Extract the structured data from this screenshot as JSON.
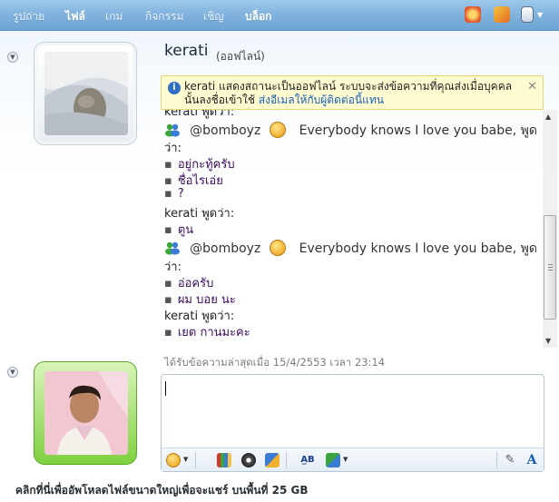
{
  "menu": {
    "photos": "รูปถ่าย",
    "files": "ไฟล์",
    "games": "เกม",
    "activities": "กิจกรรม",
    "invite": "เชิญ",
    "block": "บล็อก"
  },
  "icons": {
    "collapse_top": "chevron-down-icon",
    "collapse_bottom": "chevron-down-icon",
    "info": "info-icon",
    "close": "close-icon"
  },
  "header": {
    "name": "kerati",
    "status": "(ออฟไลน์)"
  },
  "infobar": {
    "text": "kerati แสดงสถานะเป็นออฟไลน์ ระบบจะส่งข้อความที่คุณส่งเมื่อบุคคลนั้นลงชื่อเข้าใช้",
    "link": "ส่งอีเมลให้กับผู้ติดต่อนี้แทน",
    "close": "✕"
  },
  "conversation": {
    "partial_top": "kerati พูดว่า:",
    "lines": [
      {
        "kind": "nudge",
        "user": "@bomboyz",
        "text": "Everybody knows I love you babe, พูด"
      },
      {
        "kind": "text",
        "text": "ว่า:"
      },
      {
        "kind": "item",
        "text": "อยู่กะทู้ครับ"
      },
      {
        "kind": "item",
        "text": "ชื่อไรเอ่ย"
      },
      {
        "kind": "item",
        "text": "?"
      },
      {
        "kind": "text",
        "text": "kerati พูดว่า:"
      },
      {
        "kind": "item",
        "text": "ตูน"
      },
      {
        "kind": "nudge",
        "user": "@bomboyz",
        "text": "Everybody knows I love you babe, พูด"
      },
      {
        "kind": "text",
        "text": "ว่า:"
      },
      {
        "kind": "item",
        "text": "อ่อครับ"
      },
      {
        "kind": "item",
        "text": "ผม บอย นะ"
      },
      {
        "kind": "text",
        "text": "kerati พูดว่า:"
      },
      {
        "kind": "item",
        "text": "เยต กานมะคะ"
      }
    ]
  },
  "last_received": "ได้รับข้อความล่าสุดเมื่อ 15/4/2553 เวลา 23:14",
  "input": {
    "value": ""
  },
  "footer": "คลิกที่นี่เพื่ออัพโหลดไฟล์ขนาดใหญ่เพื่อจะแชร์ บนพื้นที่ 25 GB"
}
